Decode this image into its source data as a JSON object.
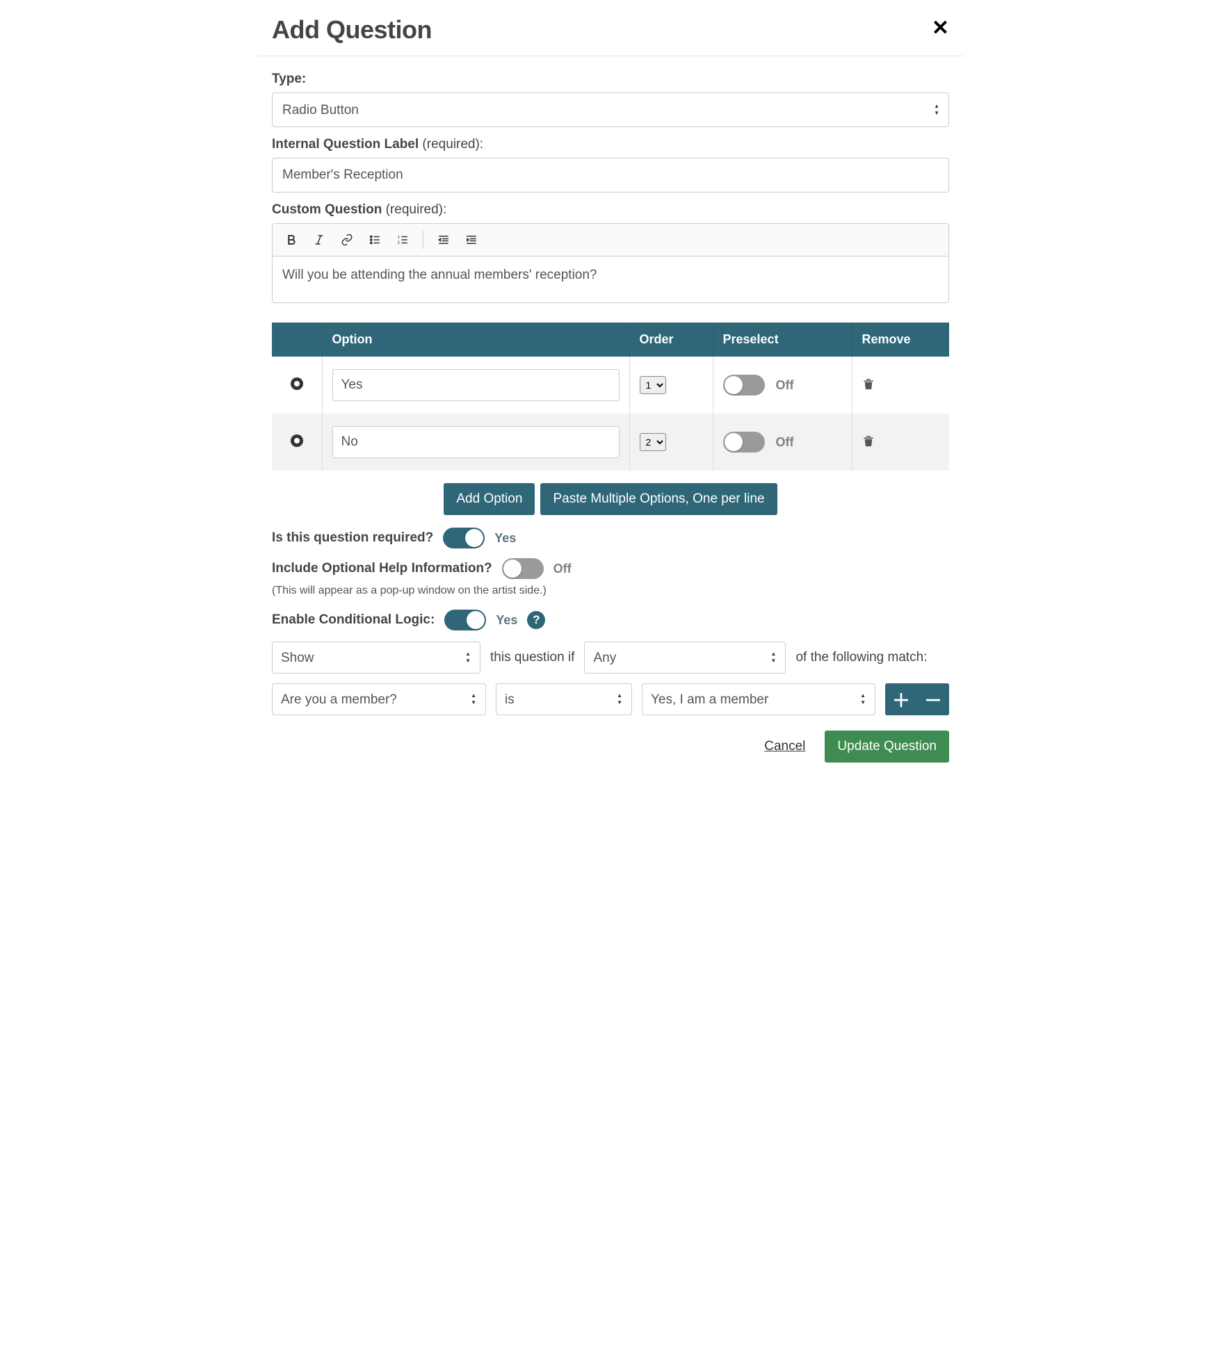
{
  "modal": {
    "title": "Add Question",
    "close_label": "×"
  },
  "type": {
    "label": "Type:",
    "value": "Radio Button"
  },
  "internal": {
    "label": "Internal Question Label",
    "suffix": " (required):",
    "value": "Member's Reception"
  },
  "custom": {
    "label": "Custom Question",
    "suffix": " (required):",
    "content": "Will you be attending the annual members' reception?"
  },
  "options_table": {
    "headers": {
      "option": "Option",
      "order": "Order",
      "preselect": "Preselect",
      "remove": "Remove"
    },
    "rows": [
      {
        "value": "Yes",
        "order": "1",
        "preselect_on": false,
        "preselect_text": "Off"
      },
      {
        "value": "No",
        "order": "2",
        "preselect_on": false,
        "preselect_text": "Off"
      }
    ]
  },
  "buttons": {
    "add_option": "Add Option",
    "paste_multi": "Paste Multiple Options, One per line",
    "cancel": "Cancel",
    "update": "Update Question"
  },
  "required_q": {
    "label": "Is this question required?",
    "value_text": "Yes",
    "on": true
  },
  "help_info": {
    "label": "Include Optional Help Information?",
    "value_text": "Off",
    "on": false,
    "hint": "(This will appear as a pop-up window on the artist side.)"
  },
  "cond": {
    "label": "Enable Conditional Logic:",
    "value_text": "Yes",
    "on": true,
    "action": "Show",
    "mid_text_1": "this question if",
    "match": "Any",
    "mid_text_2": "of the following match:",
    "rule": {
      "field": "Are you a member?",
      "op": "is",
      "value": "Yes, I am a member"
    }
  }
}
